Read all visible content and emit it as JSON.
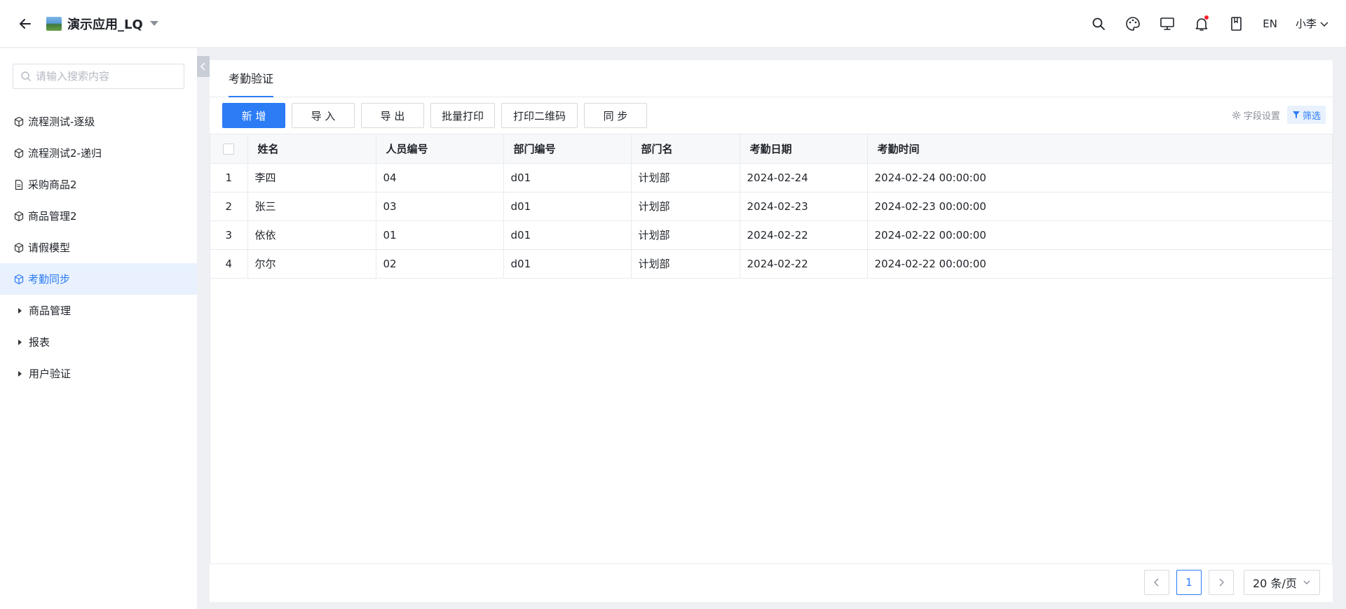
{
  "header": {
    "app_title": "演示应用_LQ",
    "lang_label": "EN",
    "user_name": "小李",
    "icons": [
      "search-icon",
      "palette-icon",
      "monitor-icon",
      "bell-icon",
      "book-icon"
    ],
    "notification_dot_color": "#f5222d"
  },
  "sidebar": {
    "search_placeholder": "请输入搜索内容",
    "items": [
      {
        "label": "流程测试-逐级",
        "icon": "cube-icon"
      },
      {
        "label": "流程测试2-递归",
        "icon": "cube-icon"
      },
      {
        "label": "采购商品2",
        "icon": "file-icon"
      },
      {
        "label": "商品管理2",
        "icon": "cube-icon"
      },
      {
        "label": "请假模型",
        "icon": "cube-icon"
      },
      {
        "label": "考勤同步",
        "icon": "cube-icon",
        "active": true
      }
    ],
    "groups": [
      {
        "label": "商品管理"
      },
      {
        "label": "报表"
      },
      {
        "label": "用户验证"
      }
    ]
  },
  "main": {
    "tab_label": "考勤验证",
    "toolbar": {
      "add": "新 增",
      "import": "导 入",
      "export": "导 出",
      "batch_print": "批量打印",
      "print_qr": "打印二维码",
      "sync": "同 步",
      "field_settings": "字段设置",
      "filter": "筛选"
    },
    "table": {
      "columns": [
        "姓名",
        "人员编号",
        "部门编号",
        "部门名",
        "考勤日期",
        "考勤时间"
      ],
      "rows": [
        {
          "index": "1",
          "name": "李四",
          "emp_no": "04",
          "dept_no": "d01",
          "dept_name": "计划部",
          "date": "2024-02-24",
          "time": "2024-02-24 00:00:00"
        },
        {
          "index": "2",
          "name": "张三",
          "emp_no": "03",
          "dept_no": "d01",
          "dept_name": "计划部",
          "date": "2024-02-23",
          "time": "2024-02-23 00:00:00"
        },
        {
          "index": "3",
          "name": "依依",
          "emp_no": "01",
          "dept_no": "d01",
          "dept_name": "计划部",
          "date": "2024-02-22",
          "time": "2024-02-22 00:00:00"
        },
        {
          "index": "4",
          "name": "尔尔",
          "emp_no": "02",
          "dept_no": "d01",
          "dept_name": "计划部",
          "date": "2024-02-22",
          "time": "2024-02-22 00:00:00"
        }
      ]
    },
    "pagination": {
      "current_page": "1",
      "page_size_label": "20 条/页"
    }
  },
  "colors": {
    "primary": "#2c7cf6",
    "active_bg": "#e8f1fd"
  }
}
